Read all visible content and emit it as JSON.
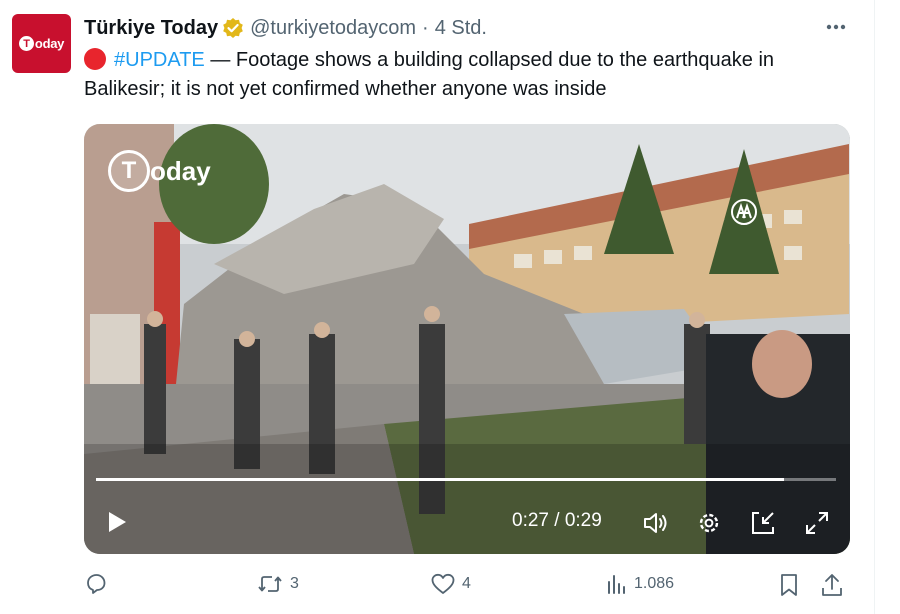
{
  "author": {
    "display_name": "Türkiye Today",
    "handle": "@turkiyetodaycom",
    "separator": "·",
    "time": "4 Std.",
    "avatar_text": "oday",
    "avatar_letter": "T"
  },
  "tweet": {
    "hashtag": "#UPDATE",
    "body": " — Footage shows a building collapsed due to the earthquake in Balikesir; it is not yet confirmed whether anyone was inside"
  },
  "video": {
    "watermark_letter": "T",
    "watermark_text": "oday",
    "time_readout": "0:27 / 0:29",
    "progress_fraction": 0.93
  },
  "actions": {
    "reply_count": "",
    "retweet_count": "3",
    "like_count": "4",
    "views_count": "1.086"
  },
  "colors": {
    "brand_red": "#c8102e",
    "link_blue": "#1d9bf0",
    "muted_text": "#536471",
    "verified_gold": "#e2b719"
  },
  "icons": [
    "more-icon",
    "verified-badge-icon",
    "play-icon",
    "volume-icon",
    "settings-icon",
    "pip-icon",
    "fullscreen-icon",
    "reply-icon",
    "retweet-icon",
    "like-icon",
    "views-icon",
    "bookmark-icon",
    "share-icon"
  ]
}
